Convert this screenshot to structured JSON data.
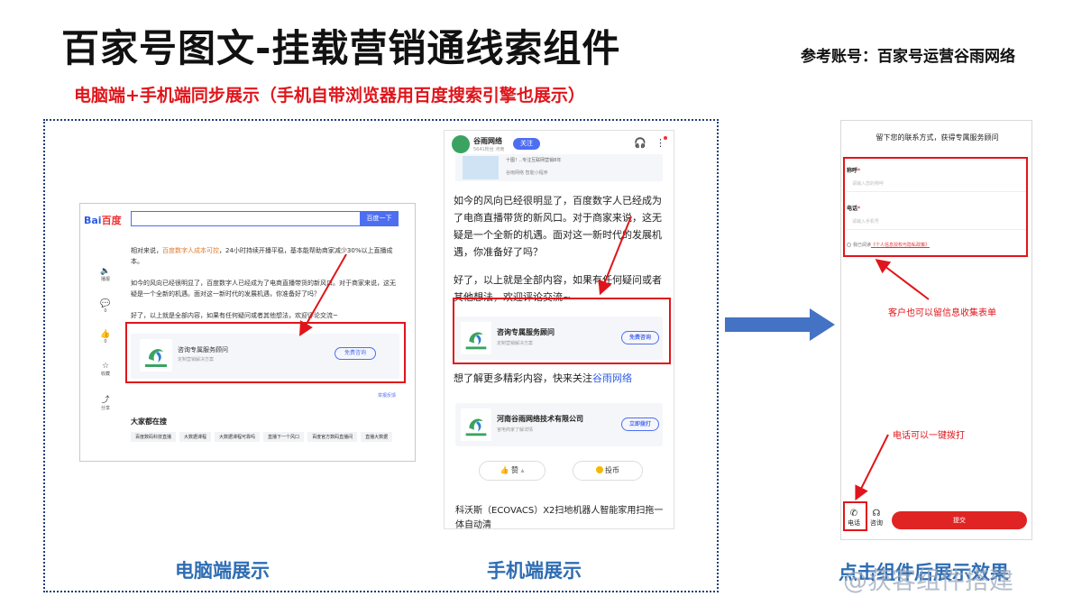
{
  "title": "百家号图文-挂载营销通线索组件",
  "reference_account": "参考账号：百家号运营谷雨网络",
  "subtitle": "电脑端+手机端同步展示（手机自带浏览器用百度搜索引擎也展示）",
  "desktop": {
    "logo_bai": "Bai",
    "logo_du": "百度",
    "search_button": "百度一下",
    "para1_pre": "相对来说，",
    "para1_hl": "百度数字人成本可控",
    "para1_post": "，24小时持续开播平稳，基本能帮助商家减少30%以上直播成本。",
    "para2": "如今的风向已经很明显了，百度数字人已经成为了电商直播带货的新风口。对于商家来说，这无疑是一个全新的机遇。面对这一新时代的发展机遇，你准备好了吗？",
    "para3": "好了，以上就是全部内容，如果有任何疑问或者其他想法，欢迎评论交流~",
    "side_items": [
      {
        "icon": "🔈",
        "label": "播报"
      },
      {
        "icon": "💬",
        "label": "0"
      },
      {
        "icon": "👍",
        "label": "0"
      },
      {
        "icon": "☆",
        "label": "收藏"
      },
      {
        "icon": "⤴",
        "label": "分享"
      }
    ],
    "card_title": "咨询专属服务顾问",
    "card_sub": "定制营销解决方案",
    "card_button": "免费咨询",
    "report": "举报反馈",
    "hot_title": "大家都在搜",
    "chips": [
      "百度数码科技直播",
      "大数据课程",
      "大数据课程可靠吗",
      "直播下一个风口",
      "百度官方数码直播间",
      "直播大数据"
    ]
  },
  "mobile": {
    "account_name": "谷雨网络",
    "account_meta": "5641粉丝 河南",
    "follow": "关注",
    "top_card_title": "十图！..专注互联网营销8年",
    "top_card_sub": "谷雨网络   智能小程序",
    "para1": "如今的风向已经很明显了，百度数字人已经成为了电商直播带货的新风口。对于商家来说，这无疑是一个全新的机遇。面对这一新时代的发展机遇，你准备好了吗？",
    "para2": "好了，以上就是全部内容，如果有任何疑问或者其他想法，欢迎评论交流~",
    "card1_title": "咨询专属服务顾问",
    "card1_sub": "定制营销解决方案",
    "card1_button": "免费咨询",
    "more_pre": "想了解更多精彩内容，快来关注",
    "more_link": "谷雨网络",
    "card2_title": "河南谷雨网络技术有限公司",
    "card2_sub": "官电商家了解详情",
    "card2_button": "立即拨打",
    "like": "赞",
    "coin": "投币",
    "news": "科沃斯（ECOVACS）X2扫地机器人智能家用扫拖一体自动清"
  },
  "form": {
    "header": "留下您的联系方式，获得专属服务顾问",
    "name_label": "称呼",
    "name_placeholder": "请输入您的称呼",
    "phone_label": "电话",
    "phone_placeholder": "请输入手机号",
    "agree_pre": "我已阅读",
    "agree_link": "《个人信息授权与隐私政策》",
    "phone_btn": "电话",
    "consult_btn": "咨询",
    "submit": "提交"
  },
  "annotations": {
    "form_note": "客户也可以留信息收集表单",
    "phone_note": "电话可以一键拨打"
  },
  "captions": {
    "desktop": "电脑端展示",
    "mobile": "手机端展示",
    "form": "点击组件后展示效果"
  },
  "watermark": "@获客组件搭建",
  "colors": {
    "accent_red": "#e0151b",
    "caption_blue": "#2e6db4",
    "arrow_blue": "#4472c4",
    "baidu_blue": "#4e6ef2"
  }
}
